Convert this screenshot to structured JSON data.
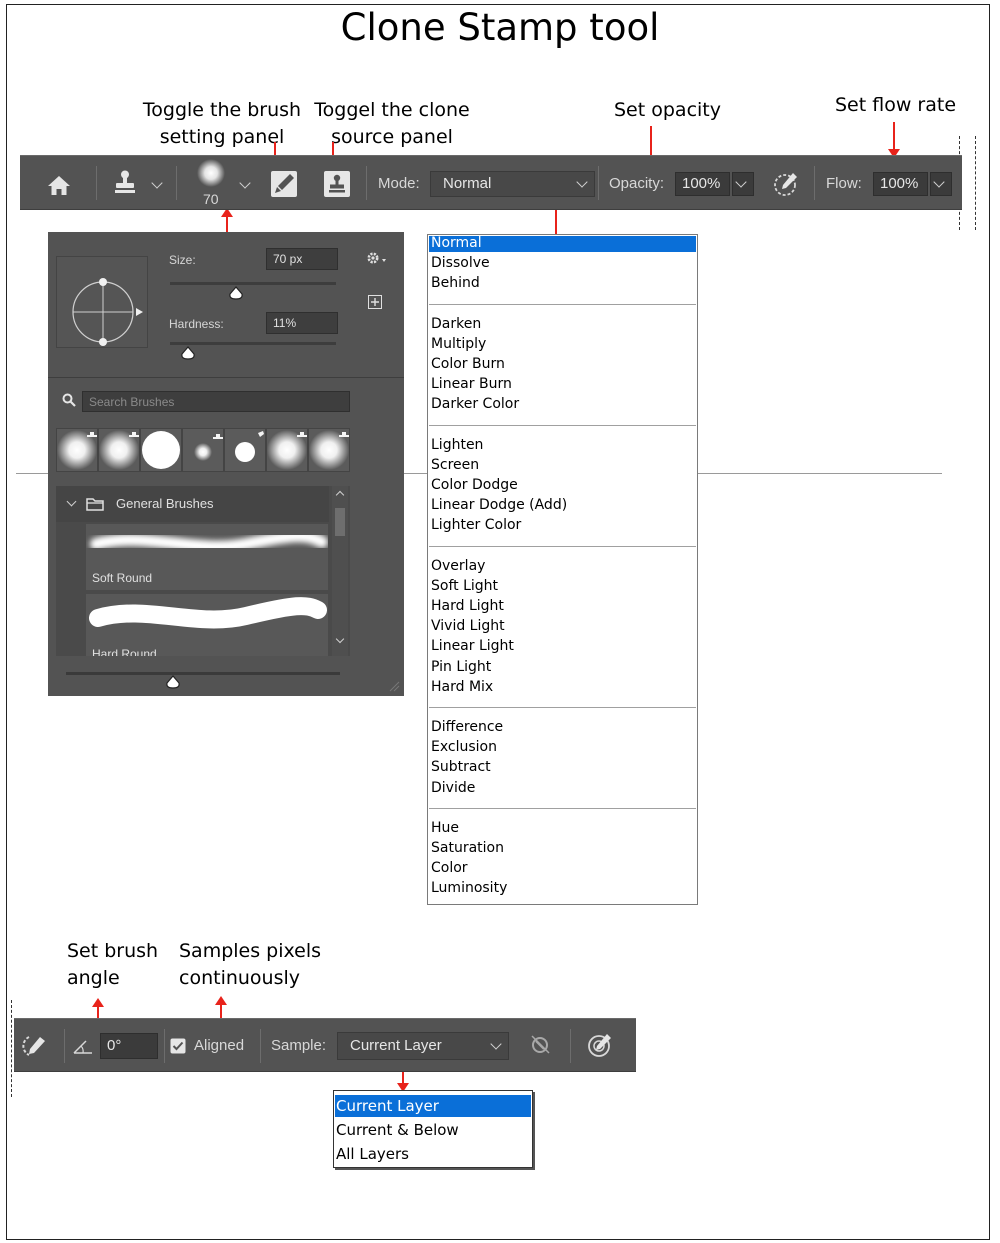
{
  "title": "Clone Stamp tool",
  "callouts": {
    "brush_setting": [
      "Toggle the brush",
      "setting panel"
    ],
    "clone_source": [
      "Toggel the clone",
      "source panel"
    ],
    "opacity": "Set opacity",
    "flow": "Set flow rate",
    "brush_angle": [
      "Set brush",
      "angle"
    ],
    "samples": [
      "Samples pixels",
      "continuously"
    ]
  },
  "toolbar": {
    "brush_size_value": "70",
    "mode_label": "Mode:",
    "mode_value": "Normal",
    "opacity_label": "Opacity:",
    "opacity_value": "100%",
    "flow_label": "Flow:",
    "flow_value": "100%",
    "icons": [
      "home-icon",
      "clone-stamp-icon",
      "brush-preset-icon",
      "brush-settings-icon",
      "clone-source-icon",
      "pressure-opacity-icon"
    ]
  },
  "brush_panel": {
    "size_label": "Size:",
    "size_value": "70 px",
    "hardness_label": "Hardness:",
    "hardness_value": "11%",
    "search_placeholder": "Search Brushes",
    "group_label": "General Brushes",
    "brushes": [
      "Soft Round",
      "Hard Round"
    ],
    "size_fraction": 0.4,
    "hardness_fraction": 0.11
  },
  "blend_modes": {
    "selected": "Normal",
    "groups": [
      [
        "Normal",
        "Dissolve",
        "Behind"
      ],
      [
        "Darken",
        "Multiply",
        "Color Burn",
        "Linear Burn",
        "Darker Color"
      ],
      [
        "Lighten",
        "Screen",
        "Color Dodge",
        "Linear Dodge (Add)",
        "Lighter Color"
      ],
      [
        "Overlay",
        "Soft Light",
        "Hard Light",
        "Vivid Light",
        "Linear Light",
        "Pin Light",
        "Hard Mix"
      ],
      [
        "Difference",
        "Exclusion",
        "Subtract",
        "Divide"
      ],
      [
        "Hue",
        "Saturation",
        "Color",
        "Luminosity"
      ]
    ]
  },
  "bottom_toolbar": {
    "angle_value": "0°",
    "aligned_label": "Aligned",
    "aligned_checked": true,
    "sample_label": "Sample:",
    "sample_value": "Current Layer"
  },
  "sample_options": {
    "selected": "Current Layer",
    "items": [
      "Current Layer",
      "Current & Below",
      "All Layers"
    ]
  },
  "colors": {
    "toolbar_bg": "#535353",
    "arrow": "#e8231b",
    "selection": "#0a6fd8"
  }
}
